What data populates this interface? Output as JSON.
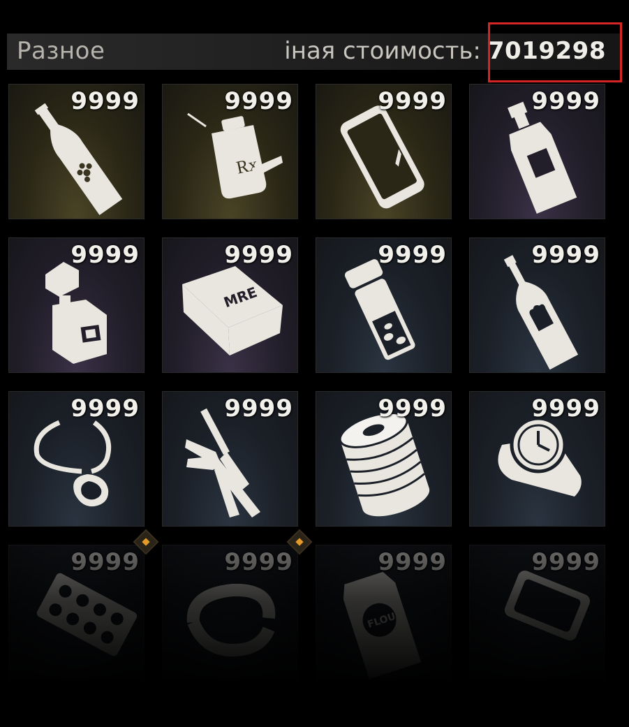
{
  "header": {
    "title": "Разное",
    "cost_label": "іная стоимость:",
    "cost_value": "7019298"
  },
  "colors": {
    "highlight": "#d62525",
    "marker": "#e39a2a"
  },
  "items": [
    {
      "count": "9999",
      "icon": "wine-bottle-icon",
      "rarity": "gold"
    },
    {
      "count": "9999",
      "icon": "prescription-drugs-icon",
      "rarity": "gold"
    },
    {
      "count": "9999",
      "icon": "smartphone-icon",
      "rarity": "gold"
    },
    {
      "count": "9999",
      "icon": "whiskey-bottle-icon",
      "rarity": "purple"
    },
    {
      "count": "9999",
      "icon": "perfume-icon",
      "rarity": "purple"
    },
    {
      "count": "9999",
      "icon": "mre-ration-icon",
      "rarity": "purple"
    },
    {
      "count": "9999",
      "icon": "pill-bottle-icon",
      "rarity": "blue"
    },
    {
      "count": "9999",
      "icon": "liquor-bottle-icon",
      "rarity": "blue"
    },
    {
      "count": "9999",
      "icon": "necklace-icon",
      "rarity": "blue"
    },
    {
      "count": "9999",
      "icon": "pliers-screwdriver-icon",
      "rarity": "blue"
    },
    {
      "count": "9999",
      "icon": "tin-can-icon",
      "rarity": "blue"
    },
    {
      "count": "9999",
      "icon": "wristwatch-icon",
      "rarity": "blue"
    },
    {
      "count": "9999",
      "icon": "pill-blister-icon",
      "rarity": "blue"
    },
    {
      "count": "9999",
      "icon": "bracelet-icon",
      "rarity": "blue"
    },
    {
      "count": "9999",
      "icon": "flour-bag-icon",
      "rarity": "blue"
    },
    {
      "count": "9999",
      "icon": "tray-icon",
      "rarity": "blue"
    }
  ]
}
